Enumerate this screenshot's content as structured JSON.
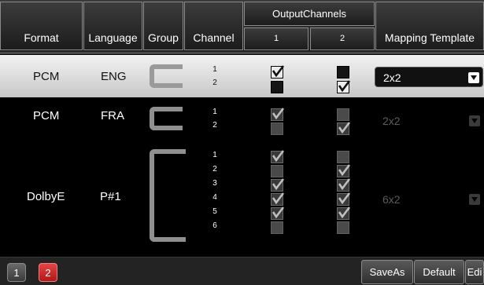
{
  "header": {
    "format": "Format",
    "language": "Language",
    "group": "Group",
    "channel": "Channel",
    "output_channels": "OutputChannels",
    "out1": "1",
    "out2": "2",
    "mapping_template": "Mapping Template"
  },
  "rows": [
    {
      "format": "PCM",
      "language": "ENG",
      "channels": [
        "1",
        "2"
      ],
      "out1": [
        true,
        false
      ],
      "out2": [
        false,
        true
      ],
      "template": "2x2",
      "selected": true
    },
    {
      "format": "PCM",
      "language": "FRA",
      "channels": [
        "1",
        "2"
      ],
      "out1": [
        true,
        false
      ],
      "out2": [
        false,
        true
      ],
      "template": "2x2",
      "selected": false
    },
    {
      "format": "DolbyE",
      "language": "P#1",
      "channels": [
        "1",
        "2",
        "3",
        "4",
        "5",
        "6"
      ],
      "out1": [
        true,
        false,
        true,
        true,
        true,
        false
      ],
      "out2": [
        false,
        true,
        true,
        true,
        true,
        false
      ],
      "template": "6x2",
      "selected": false
    }
  ],
  "footer": {
    "pages": [
      "1",
      "2"
    ],
    "active_page": "2",
    "save_as": "SaveAs",
    "default": "Default",
    "edit": "Edi"
  },
  "colors": {
    "selected_row_bg": "#e0e0e0",
    "active_page_btn": "#d32a2a",
    "header_border": "#8a8a8a"
  }
}
